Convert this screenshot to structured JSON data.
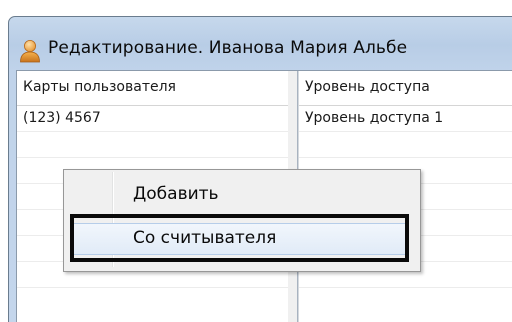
{
  "window": {
    "title": "Редактирование. Иванова Мария Альбе",
    "icon": "user-icon"
  },
  "cards_table": {
    "header": "Карты пользователя",
    "rows": [
      "(123) 4567"
    ]
  },
  "access_table": {
    "header": "Уровень доступа",
    "rows": [
      "Уровень доступа 1"
    ]
  },
  "context_menu": {
    "items": [
      {
        "label": "Добавить",
        "highlighted": false
      },
      {
        "label": "Со считывателя",
        "highlighted": true
      }
    ]
  },
  "colors": {
    "titlebar": "#b8cde6",
    "menu_background": "#f0f0f0",
    "menu_highlight": "#e1ebf7",
    "callout_border": "#0a0a0a"
  }
}
